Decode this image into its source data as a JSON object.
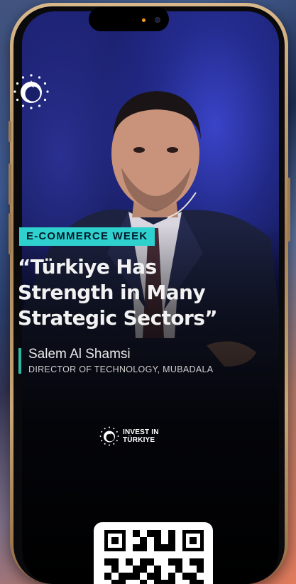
{
  "category": "E-COMMERCE WEEK",
  "headline": "“Türkiye Has Strength in Many Strategic Sectors”",
  "speaker": {
    "name": "Salem Al Shamsi",
    "title": "DIRECTOR OF TECHNOLOGY, MUBADALA"
  },
  "brand": {
    "line1": "INVEST IN",
    "line2": "TÜRKIYE"
  },
  "colors": {
    "accent_teal": "#2fd1cf",
    "accent_bar": "#2fb8a6",
    "phone_frame": "#c9a676"
  },
  "icons": [
    "crescent-logo-icon",
    "invest-in-turkiye-logo-icon",
    "qr-code-icon",
    "front-camera-icon"
  ]
}
